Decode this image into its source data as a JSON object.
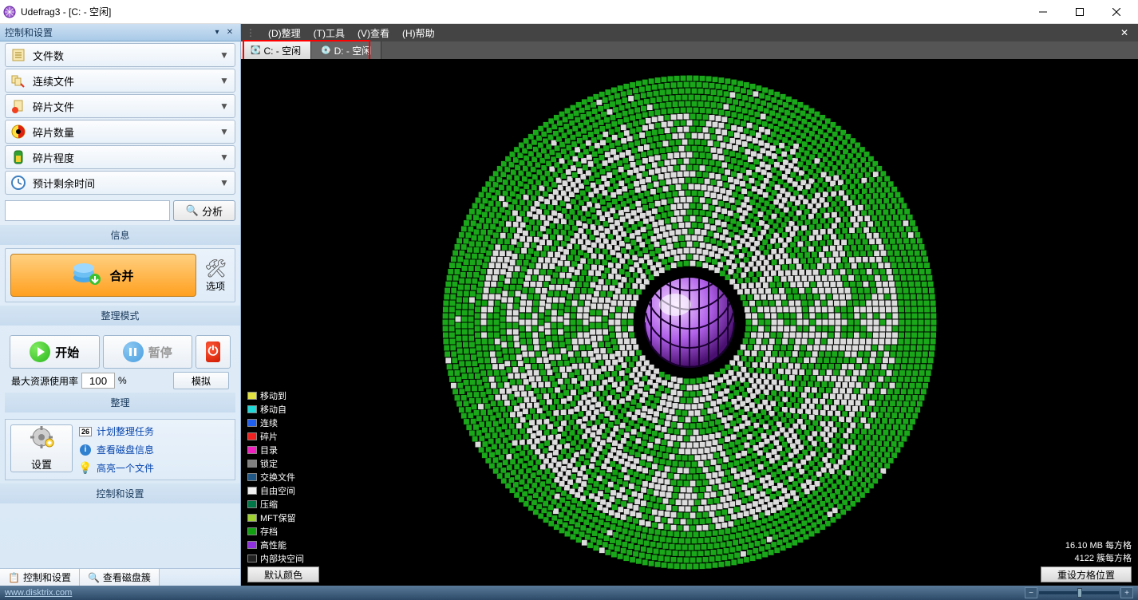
{
  "window": {
    "title": "Udefrag3 - [C: - 空闲]"
  },
  "sidebar": {
    "header": "控制和设置",
    "metrics": [
      {
        "label": "文件数"
      },
      {
        "label": "连续文件"
      },
      {
        "label": "碎片文件"
      },
      {
        "label": "碎片数量"
      },
      {
        "label": "碎片程度"
      },
      {
        "label": "预计剩余时间"
      }
    ],
    "analyze": "分析",
    "info_title": "信息",
    "merge": "合并",
    "options": "选项",
    "mode_title": "整理模式",
    "start": "开始",
    "pause": "暂停",
    "resource_label": "最大资源使用率",
    "resource_value": "100",
    "resource_unit": "%",
    "simulate": "模拟",
    "section_sim": "整理",
    "settings": "设置",
    "links": [
      {
        "text": "计划整理任务",
        "icon": "calendar",
        "badge": "26"
      },
      {
        "text": "查看磁盘信息",
        "icon": "info"
      },
      {
        "text": "高亮一个文件",
        "icon": "bulb"
      }
    ],
    "ctrl_title": "控制和设置",
    "bottom_tabs": [
      {
        "label": "控制和设置"
      },
      {
        "label": "查看磁盘簇"
      }
    ]
  },
  "menu": {
    "items": [
      "(D)整理",
      "(T)工具",
      "(V)查看",
      "(H)帮助"
    ]
  },
  "drive_tabs": [
    {
      "label": "C: - 空闲",
      "active": true
    },
    {
      "label": "D: - 空闲",
      "active": false
    }
  ],
  "legend": [
    {
      "label": "移动到",
      "color": "#e0e040"
    },
    {
      "label": "移动自",
      "color": "#20d8d8"
    },
    {
      "label": "连续",
      "color": "#2060f0"
    },
    {
      "label": "碎片",
      "color": "#f02020"
    },
    {
      "label": "目录",
      "color": "#f020c0"
    },
    {
      "label": "锁定",
      "color": "#808080"
    },
    {
      "label": "交换文件",
      "color": "#205888"
    },
    {
      "label": "自由空间",
      "color": "#f0f0f0"
    },
    {
      "label": "压缩",
      "color": "#007848"
    },
    {
      "label": "MFT保留",
      "color": "#9dd030"
    },
    {
      "label": "存档",
      "color": "#10a010"
    },
    {
      "label": "高性能",
      "color": "#9030e0"
    },
    {
      "label": "内部块空间",
      "color": "#202020"
    }
  ],
  "bottom": {
    "default_colors": "默认颜色",
    "reset_grid": "重设方格位置"
  },
  "info": {
    "per_square": "16.10 MB 每方格",
    "clusters": "4122 簇每方格"
  },
  "status": {
    "url": "www.disktrix.com"
  }
}
